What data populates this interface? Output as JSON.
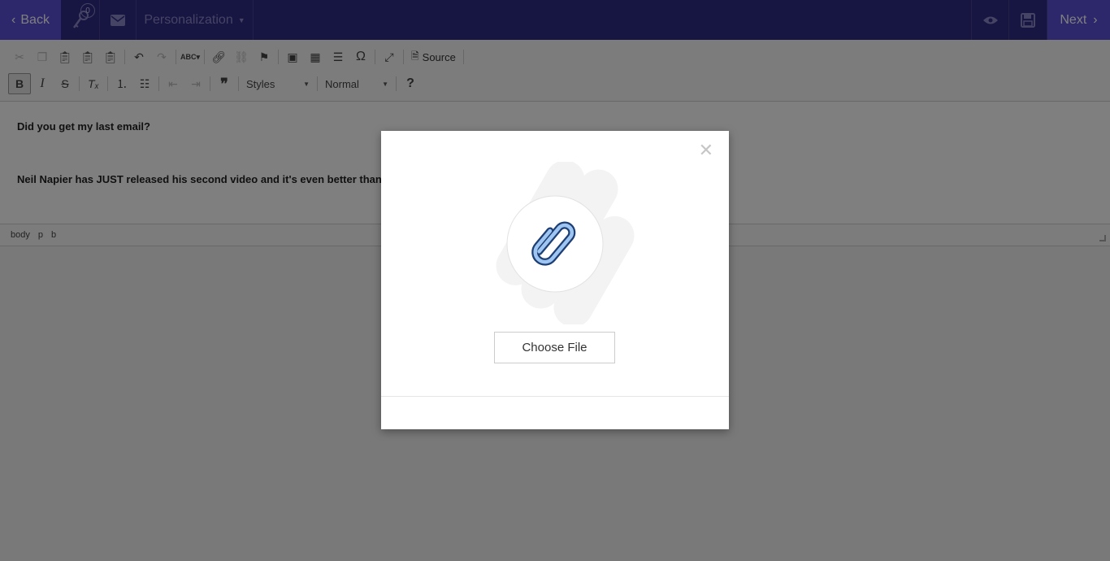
{
  "topbar": {
    "back_label": "Back",
    "keys_count": "0",
    "personalization_label": "Personalization",
    "next_label": "Next"
  },
  "toolbar": {
    "source_label": "Source",
    "styles_label": "Styles",
    "format_label": "Normal",
    "help_label": "?"
  },
  "editor": {
    "line1": "Did you get my last email?",
    "line2": "Neil Napier has JUST released his second video and it's even better than"
  },
  "statusbar": {
    "path": [
      "body",
      "p",
      "b"
    ]
  },
  "modal": {
    "close_glyph": "✕",
    "choose_file_label": "Choose File"
  },
  "colors": {
    "topbar_bg": "#2f2a85",
    "accent": "#5a4fd6",
    "paperclip_fill": "#9fc6f2",
    "paperclip_stroke": "#1e3f74"
  }
}
